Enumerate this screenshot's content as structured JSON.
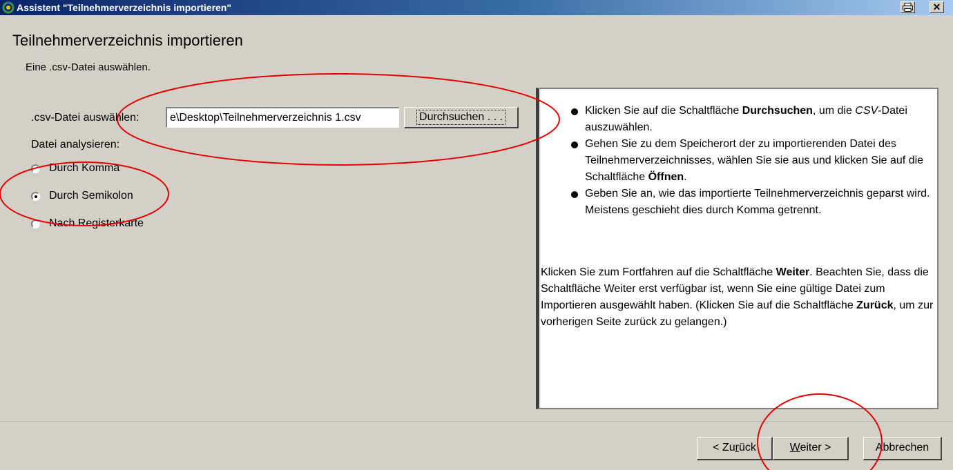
{
  "window": {
    "title": "Assistent \"Teilnehmerverzeichnis importieren\"",
    "close_glyph": "✕"
  },
  "page": {
    "title": "Teilnehmerverzeichnis importieren",
    "subtitle": "Eine .csv-Datei auswählen."
  },
  "file_select": {
    "label": ".csv-Datei auswählen:",
    "value": "e\\Desktop\\Teilnehmerverzeichnis 1.csv",
    "browse_label": "Durchsuchen . . ."
  },
  "analyze": {
    "label": "Datei analysieren:",
    "options": [
      {
        "label": "Durch Komma",
        "selected": false
      },
      {
        "label": "Durch Semikolon",
        "selected": true
      },
      {
        "label": "Nach Registerkarte",
        "selected": false
      }
    ]
  },
  "help": {
    "item1_pre": "Klicken Sie auf die Schaltfläche ",
    "item1_bold": "Durchsuchen",
    "item1_mid": ", um die ",
    "item1_italic": "CSV",
    "item1_post": "-Datei auszuwählen.",
    "item2_pre": "Gehen Sie zu dem Speicherort der zu importierenden Datei des Teilnehmerverzeichnisses, wählen Sie sie aus und klicken Sie auf die Schaltfläche ",
    "item2_bold": "Öffnen",
    "item2_post": ".",
    "item3": "Geben Sie an, wie das importierte Teilnehmerverzeichnis geparst wird. Meistens geschieht dies durch Komma getrennt.",
    "para_pre": "Klicken Sie zum Fortfahren auf die Schaltfläche ",
    "para_bold1": "Weiter",
    "para_mid": ". Beachten Sie, dass die Schaltfläche Weiter erst verfügbar ist, wenn Sie eine gültige Datei zum Importieren ausgewählt haben. (Klicken Sie auf die Schaltfläche ",
    "para_bold2": "Zurück",
    "para_post": ", um zur vorherigen Seite zurück zu gelangen.)"
  },
  "buttons": {
    "back_pre": "< Zu",
    "back_u": "r",
    "back_post": "ück",
    "next_u": "W",
    "next_post": "eiter >",
    "cancel": "Abbrechen"
  },
  "colors": {
    "annotation": "#e00000",
    "titlebar_start": "#0a246a",
    "titlebar_end": "#a6caf0"
  }
}
